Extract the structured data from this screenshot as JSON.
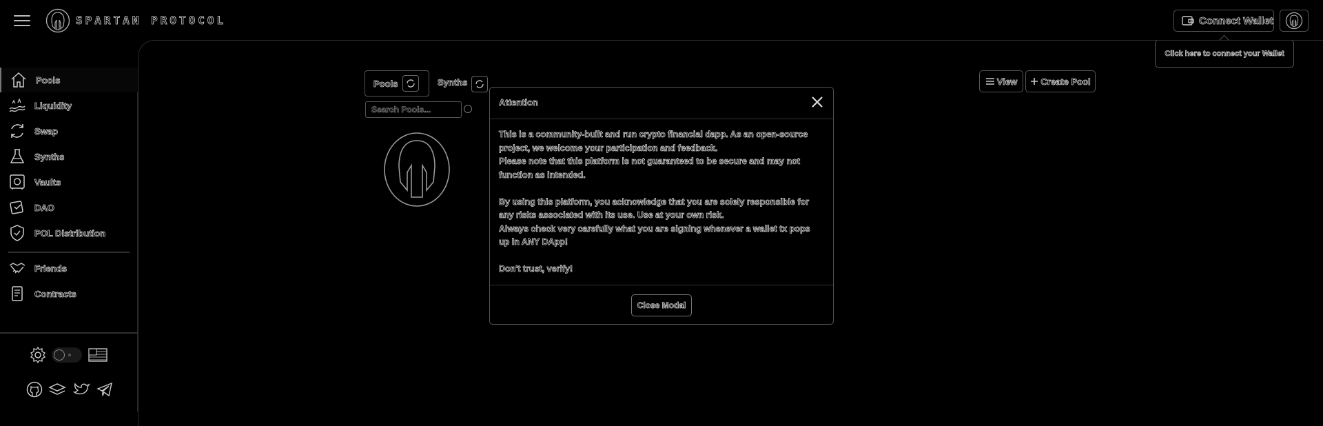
{
  "app": {
    "brand": "SPARTAN PROTOCOL"
  },
  "header": {
    "connect_label": "Connect Wallet",
    "tooltip": "Click here to connect your Wallet"
  },
  "sidebar": {
    "items": [
      {
        "label": "Pools",
        "icon": "home-icon"
      },
      {
        "label": "Liquidity",
        "icon": "liquidity-icon"
      },
      {
        "label": "Swap",
        "icon": "swap-icon"
      },
      {
        "label": "Synths",
        "icon": "flask-icon"
      },
      {
        "label": "Vaults",
        "icon": "vault-icon"
      },
      {
        "label": "DAO",
        "icon": "dao-icon"
      },
      {
        "label": "POL Distribution",
        "icon": "shield-icon"
      },
      {
        "label": "Friends",
        "icon": "handshake-icon"
      },
      {
        "label": "Contracts",
        "icon": "document-icon"
      }
    ],
    "footer_icons": [
      "gear-icon",
      "theme-toggle-icon",
      "us-flag-icon",
      "github-icon",
      "docs-icon",
      "twitter-icon",
      "telegram-icon"
    ]
  },
  "pools": {
    "tab_pools": "Pools",
    "tab_synths": "Synths",
    "search_placeholder": "Search Pools...",
    "view_label": "View",
    "create_label": "Create Pool"
  },
  "modal": {
    "title": "Attention",
    "p1": "This is a community-built and run crypto financial dapp. As an open-source project, we welcome your participation and feedback.",
    "p2": "Please note that this platform is not guaranteed to be secure and may not function as intended.",
    "p3": "By using this platform, you acknowledge that you are solely responsible for any risks associated with its use. Use at your own risk.",
    "p4": "Always check very carefully what you are signing whenever a wallet tx pops up in ANY DApp!",
    "p5": "Don't trust, verify!",
    "close_label": "Close Modal"
  }
}
